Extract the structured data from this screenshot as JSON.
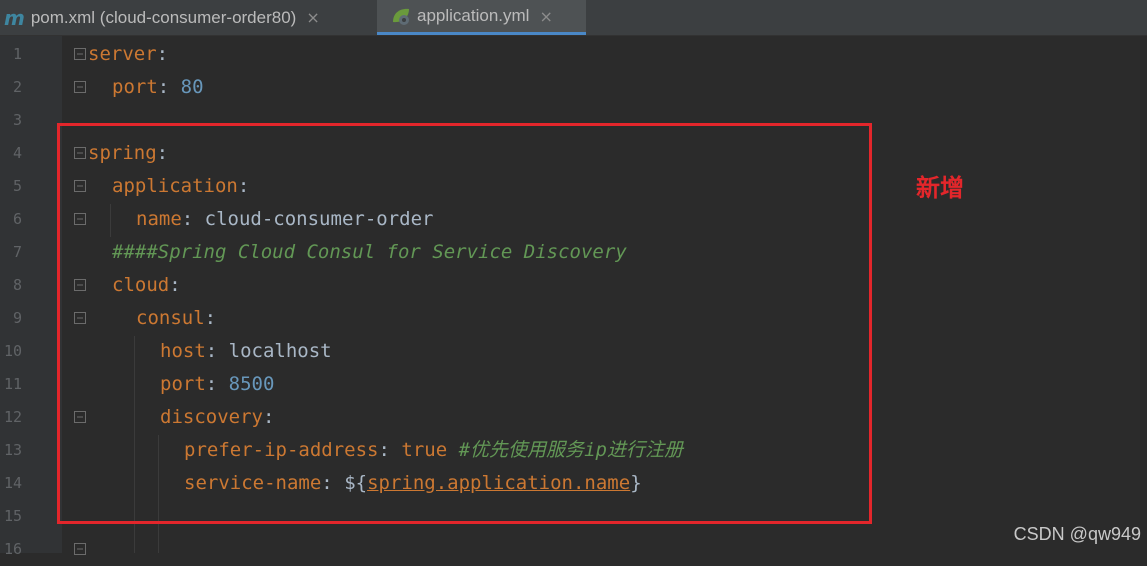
{
  "tabs": [
    {
      "icon": "m-icon",
      "icon_glyph": "m",
      "label": "pom.xml (cloud-consumer-order80)",
      "close": "×"
    },
    {
      "icon": "spring-yml-icon",
      "label": "application.yml",
      "close": "×",
      "active": true
    }
  ],
  "line_numbers": [
    "1",
    "2",
    "3",
    "4",
    "5",
    "6",
    "7",
    "8",
    "9",
    "10",
    "11",
    "12",
    "13",
    "14",
    "15",
    "16"
  ],
  "code": {
    "l1_key": "server",
    "colon": ":",
    "l2_key": "port",
    "l2_val": "80",
    "l4_key": "spring",
    "l5_key": "application",
    "l6_key": "name",
    "l6_val": "cloud-consumer-order",
    "l7_comment": "####Spring Cloud Consul for Service Discovery",
    "l8_key": "cloud",
    "l9_key": "consul",
    "l10_key": "host",
    "l10_val": "localhost",
    "l11_key": "port",
    "l11_val": "8500",
    "l12_key": "discovery",
    "l13_key": "prefer-ip-address",
    "l13_val": "true",
    "l13_comment_hash": "#",
    "l13_comment_a": "优先使用服务",
    "l13_comment_b": "ip",
    "l13_comment_c": "进行注册",
    "l14_key": "service-name",
    "l14_prefix": "${",
    "l14_ref": "spring.application.name",
    "l14_suffix": "}"
  },
  "annotation": "新增",
  "watermark": "CSDN @qw949",
  "colors": {
    "highlight_box": "#e3262b",
    "keyword": "#cc7832",
    "number": "#6897bb",
    "comment": "#629755"
  }
}
